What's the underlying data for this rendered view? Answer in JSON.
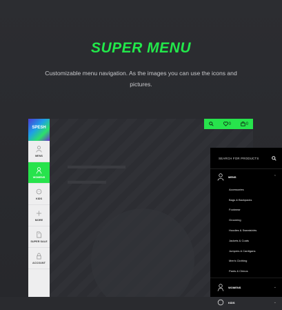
{
  "hero": {
    "title": "SUPER MENU",
    "subtitle": "Customizable menu navigation. As the images you can use the icons and pictures."
  },
  "brand": {
    "logo_text": "SPESH"
  },
  "sidebar": {
    "items": [
      {
        "label": "MENS"
      },
      {
        "label": "WOMENS"
      },
      {
        "label": "KIDS"
      },
      {
        "label": "MORE"
      },
      {
        "label": "SUPER SALE"
      },
      {
        "label": "ACCOUNT"
      }
    ]
  },
  "topbar": {
    "wishlist_count": "0",
    "cart_count": "0"
  },
  "drawer": {
    "search_placeholder": "SEARCH FOR PRODUCTS",
    "categories": [
      {
        "label": "MENS",
        "expanded": true
      },
      {
        "label": "WOMENS",
        "expanded": false
      },
      {
        "label": "KIDS",
        "expanded": false
      }
    ],
    "subitems": [
      "Accessories",
      "Bags & Backpacks",
      "Footwear",
      "Grooming",
      "Hoodies & Sweatshirts",
      "Jackets & Coats",
      "Jumpers & Cardigans",
      "Men's Clothing",
      "Pants & Chinos"
    ]
  },
  "colors": {
    "accent": "#27e34c",
    "background": "#2a2b2f",
    "drawer": "#000000"
  }
}
